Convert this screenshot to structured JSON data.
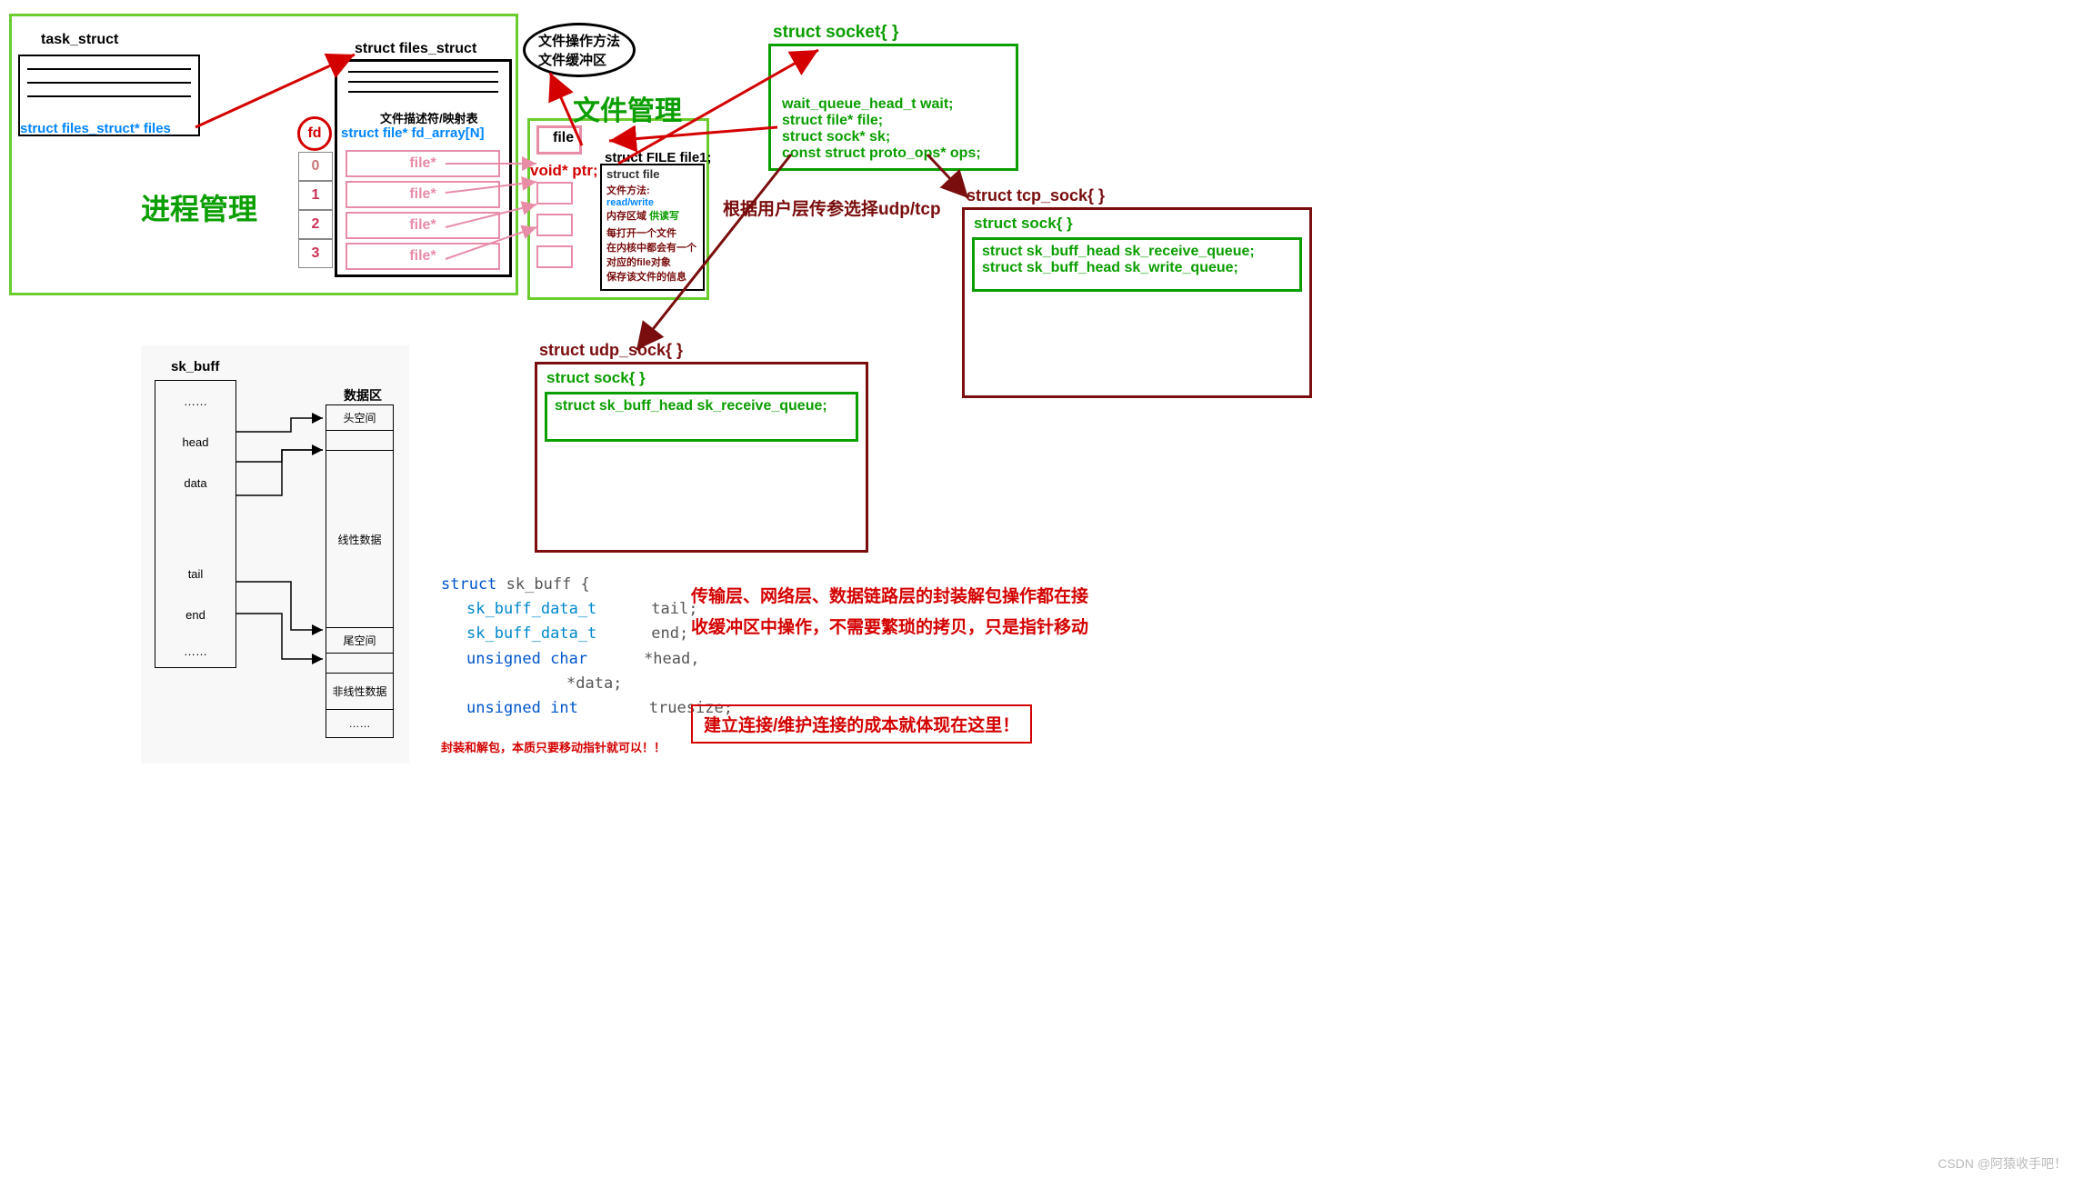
{
  "process": {
    "title": "进程管理",
    "task_struct_label": "task_struct",
    "files_struct_label": "struct files_struct",
    "files_ptr": "struct files_struct* files",
    "fd_table_title": "文件描述符/映射表",
    "fd_array_decl": "struct file* fd_array[N]",
    "fd_label": "fd",
    "fd_numbers": [
      "0",
      "1",
      "2",
      "3"
    ],
    "file_ptr_label": "file*"
  },
  "file_mgmt": {
    "title": "文件管理",
    "bubble_line1": "文件操作方法",
    "bubble_line2": "文件缓冲区",
    "file_label": "file",
    "void_ptr": "void* ptr;",
    "file1_decl": "struct FILE file1;",
    "struct_file": "struct file",
    "methods_label": "文件方法:",
    "methods_val": "read/write",
    "buffer_label": "内存区域",
    "buffer_val": "供读写",
    "info_l1": "每打开一个文件",
    "info_l2": "在内核中都会有一个",
    "info_l3": "对应的file对象",
    "info_l4": "保存该文件的信息"
  },
  "socket": {
    "title": "struct socket{ }",
    "l1": "wait_queue_head_t wait;",
    "l2": "struct file* file;",
    "l3": "struct sock* sk;",
    "l4": "const struct proto_ops* ops;",
    "select_note": "根据用户层传参选择udp/tcp"
  },
  "tcp": {
    "title": "struct tcp_sock{ }",
    "sock": "struct sock{ }",
    "l1": "struct sk_buff_head sk_receive_queue;",
    "l2": "struct sk_buff_head sk_write_queue;"
  },
  "udp": {
    "title": "struct udp_sock{ }",
    "sock": "struct sock{ }",
    "l1": "struct sk_buff_head sk_receive_queue;"
  },
  "skbuff": {
    "label": "sk_buff",
    "rows": [
      "……",
      "head",
      "data",
      "tail",
      "end",
      "……"
    ],
    "data_area_title": "数据区",
    "head_space": "头空间",
    "linear_data": "线性数据",
    "tail_space": "尾空间",
    "nonlinear": "非线性数据",
    "dots": "……"
  },
  "code": {
    "l1a": "struct",
    "l1b": " sk_buff {",
    "l2a": "sk_buff_data_t",
    "l2b": "tail;",
    "l3a": "sk_buff_data_t",
    "l3b": "end;",
    "l4a": "unsigned char",
    "l4b": "*head,",
    "l5b": "*data;",
    "l6a": "unsigned int",
    "l6b": "truesize;"
  },
  "notes": {
    "packing_note": "封装和解包，本质只要移动指针就可以！！",
    "layer_note_l1": "传输层、网络层、数据链路层的封装解包操作都在接",
    "layer_note_l2": "收缓冲区中操作，不需要繁琐的拷贝，只是指针移动",
    "cost_note": "建立连接/维护连接的成本就体现在这里！"
  },
  "watermark": "CSDN @阿猿收手吧！"
}
